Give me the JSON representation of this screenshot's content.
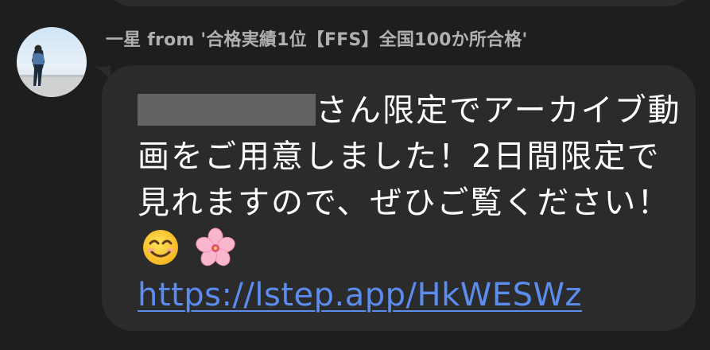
{
  "sender": {
    "name": "一星 from '合格実績1位【FFS】全国100か所合格'"
  },
  "message": {
    "redacted": true,
    "text_after_redaction": "さん限定でアーカイブ動画をご用意しました！2日間限定で見れますので、ぜひご覧ください！",
    "emojis": [
      "smiling-face-with-smiling-eyes",
      "cherry-blossom"
    ],
    "link": "https://lstep.app/HkWESWz"
  },
  "colors": {
    "background": "#1e1e1e",
    "bubble": "#2b2b2b",
    "sender_text": "#b0b0b0",
    "message_text": "#ffffff",
    "link": "#5b8cf0",
    "redaction": "#636363"
  }
}
